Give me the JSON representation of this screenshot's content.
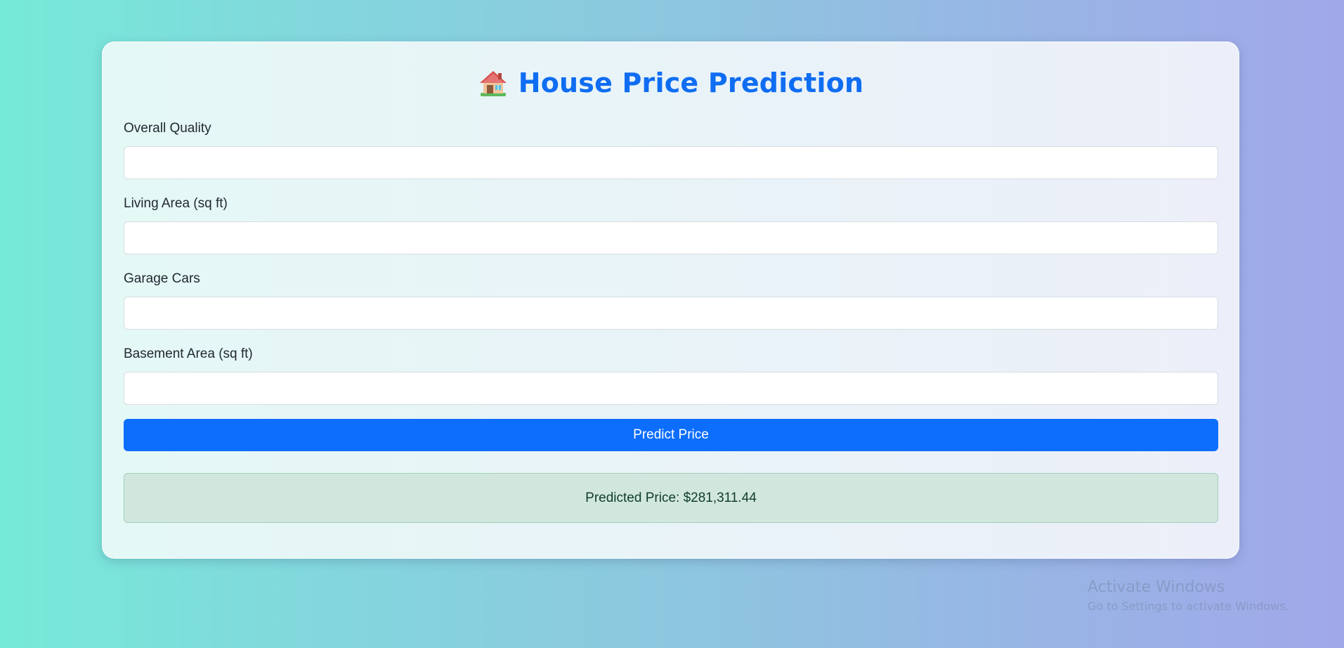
{
  "header": {
    "title": "House Price Prediction",
    "icon": "house-icon"
  },
  "form": {
    "fields": [
      {
        "label": "Overall Quality",
        "value": "",
        "placeholder": ""
      },
      {
        "label": "Living Area (sq ft)",
        "value": "",
        "placeholder": ""
      },
      {
        "label": "Garage Cars",
        "value": "",
        "placeholder": ""
      },
      {
        "label": "Basement Area (sq ft)",
        "value": "",
        "placeholder": ""
      }
    ],
    "submit_label": "Predict Price"
  },
  "result": {
    "text": "Predicted Price: $281,311.44"
  },
  "watermark": {
    "title": "Activate Windows",
    "subtitle": "Go to Settings to activate Windows."
  },
  "colors": {
    "accent": "#0d6efd",
    "title": "#0f6df2",
    "success_bg": "#d1e7dd",
    "success_border": "#a3cfbb"
  }
}
